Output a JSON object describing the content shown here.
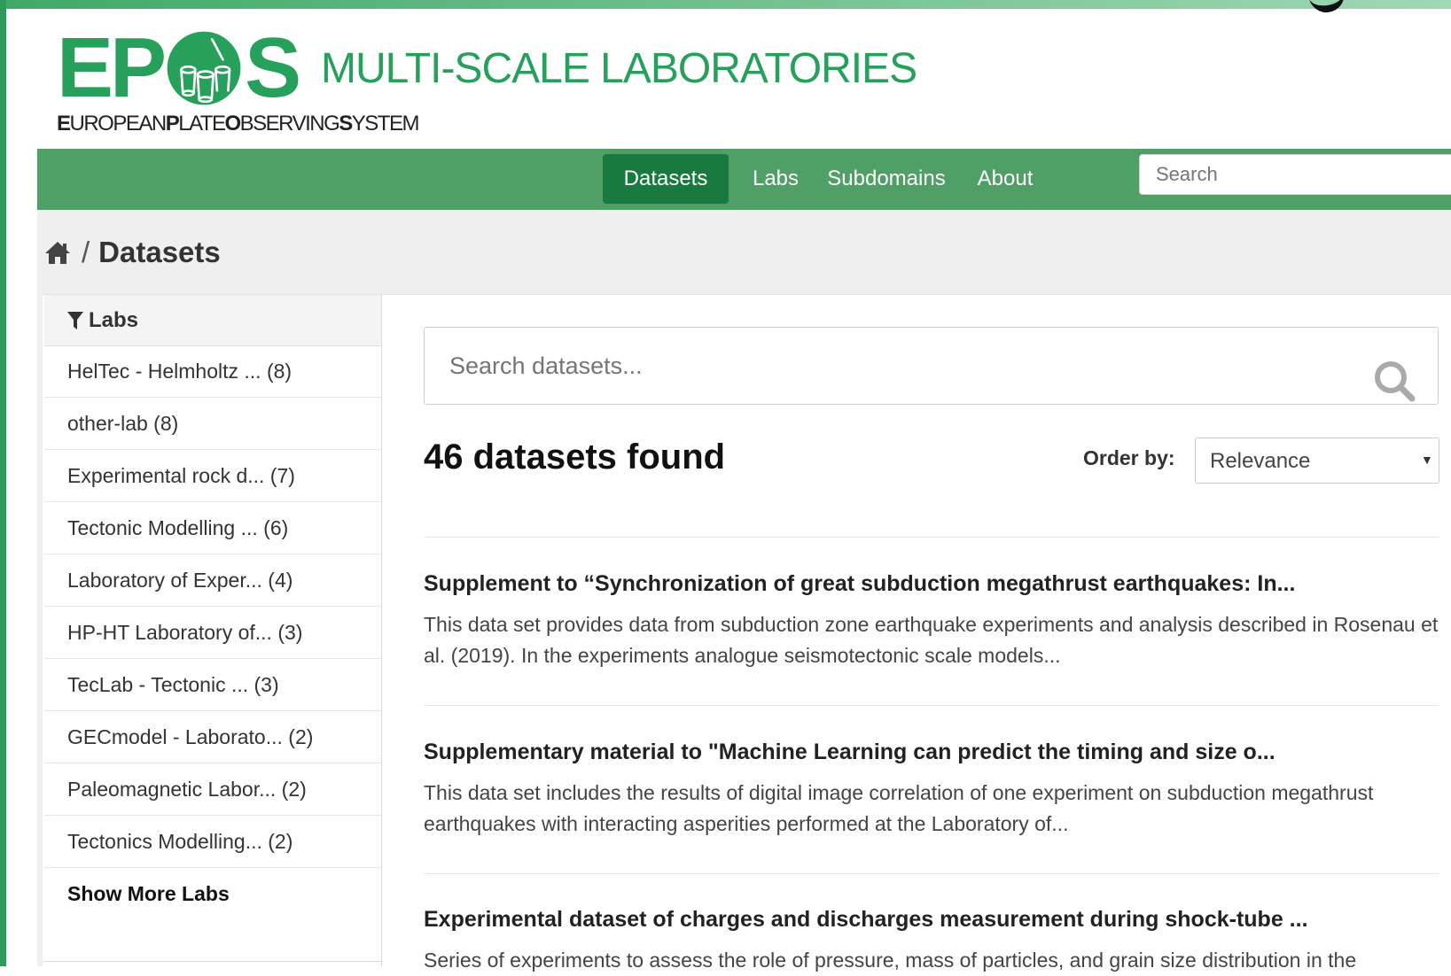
{
  "header": {
    "logo_letters": [
      "E",
      "P",
      "S"
    ],
    "logo_subtitle_parts": [
      {
        "bold": "E",
        "rest": "UROPEAN"
      },
      {
        "bold": "P",
        "rest": "LATE"
      },
      {
        "bold": "O",
        "rest": "BSERVING"
      },
      {
        "bold": "S",
        "rest": "YSTEM"
      }
    ],
    "site_title": "MULTI-SCALE LABORATORIES",
    "brand_color": "#27a05b"
  },
  "nav": {
    "items": [
      "Datasets",
      "Labs",
      "Subdomains",
      "About"
    ],
    "active": "Datasets",
    "search_placeholder": "Search",
    "bar_color": "#4f9f67",
    "active_color": "#187a3f"
  },
  "breadcrumb": {
    "separator": "/",
    "current": "Datasets"
  },
  "facets": {
    "heading": "Labs",
    "items": [
      "HelTec - Helmholtz ... (8)",
      "other-lab (8)",
      "Experimental rock d... (7)",
      "Tectonic Modelling ... (6)",
      "Laboratory of Exper... (4)",
      "HP-HT Laboratory of... (3)",
      "TecLab - Tectonic ... (3)",
      "GECmodel - Laborato... (2)",
      "Paleomagnetic Labor... (2)",
      "Tectonics Modelling... (2)"
    ],
    "show_more": "Show More Labs"
  },
  "search": {
    "placeholder": "Search datasets..."
  },
  "results": {
    "count_text": "46 datasets found",
    "order_label": "Order by:",
    "order_value": "Relevance"
  },
  "datasets": [
    {
      "title": "Supplement to “Synchronization of great subduction megathrust earthquakes: In...",
      "description": "This data set provides data from subduction zone earthquake experiments and analysis described in Rosenau et al. (2019). In the experiments analogue seismotectonic scale models..."
    },
    {
      "title": "Supplementary material to \"Machine Learning can predict the timing and size o...",
      "description": "This data set includes the results of digital image correlation of one experiment on subduction megathrust earthquakes with interacting asperities performed at the Laboratory of..."
    },
    {
      "title": "Experimental dataset of charges and discharges measurement during shock-tube ...",
      "description": "Series of experiments to assess the role of pressure, mass of particles, and grain size distribution in the"
    }
  ]
}
